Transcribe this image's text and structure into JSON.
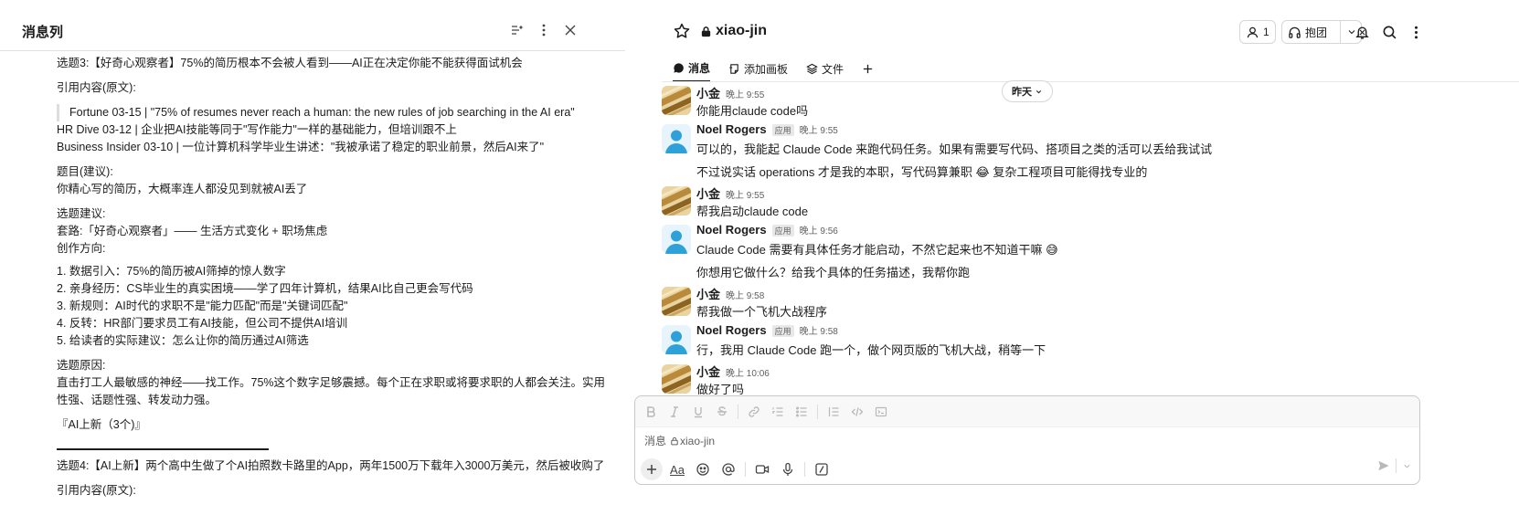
{
  "thread": {
    "title": "消息列",
    "lines": [
      {
        "text": "选题3:【好奇心观察者】75%的简历根本不会被人看到——AI正在决定你能不能获得面试机会",
        "gap": ""
      },
      {
        "text": "引用内容(原文):",
        "gap": "m"
      },
      {
        "text": "Fortune 03-15 | \"75% of resumes never reach a human: the new rules of job searching in the AI era\"",
        "quote": true
      },
      {
        "text": "HR Dive 03-12 | 企业把AI技能等同于\"写作能力\"一样的基础能力，但培训跟不上",
        "gap": ""
      },
      {
        "text": "Business Insider 03-10 | 一位计算机科学毕业生讲述：\"我被承诺了稳定的职业前景，然后AI来了\"",
        "gap": ""
      },
      {
        "text": "题目(建议):",
        "gap": "m"
      },
      {
        "text": "你精心写的简历，大概率连人都没见到就被AI丢了",
        "gap": ""
      },
      {
        "text": "选题建议:",
        "gap": "m"
      },
      {
        "text": "套路:「好奇心观察者」—— 生活方式变化 + 职场焦虑",
        "gap": ""
      },
      {
        "text": "创作方向:",
        "gap": ""
      },
      {
        "text": "1. 数据引入：75%的简历被AI筛掉的惊人数字",
        "gap": "s"
      },
      {
        "text": "2. 亲身经历：CS毕业生的真实困境——学了四年计算机，结果AI比自己更会写代码",
        "gap": ""
      },
      {
        "text": "3. 新规则：AI时代的求职不是\"能力匹配\"而是\"关键词匹配\"",
        "gap": ""
      },
      {
        "text": "4. 反转：HR部门要求员工有AI技能，但公司不提供AI培训",
        "gap": ""
      },
      {
        "text": "5. 给读者的实际建议：怎么让你的简历通过AI筛选",
        "gap": ""
      },
      {
        "text": "选题原因:",
        "gap": "m"
      },
      {
        "text": "直击打工人最敏感的神经——找工作。75%这个数字足够震撼。每个正在求职或将要求职的人都会关注。实用性强、话题性强、转发动力强。",
        "gap": "",
        "wrap": true
      },
      {
        "text": "『AI上新（3个)』",
        "gap": "m"
      }
    ],
    "after_divider": [
      {
        "text": "选题4:【AI上新】两个高中生做了个AI拍照数卡路里的App，两年1500万下载年入3000万美元，然后被收购了",
        "wrap": true
      },
      {
        "text": "引用内容(原文):",
        "gap": "m"
      }
    ]
  },
  "channel": {
    "name": "xiao-jin",
    "member_count": "1",
    "huddle_label": "抱团",
    "tabs": [
      {
        "label": "消息",
        "icon": "message-icon",
        "active": true
      },
      {
        "label": "添加画板",
        "icon": "canvas-icon",
        "active": false
      },
      {
        "label": "文件",
        "icon": "files-icon",
        "active": false
      }
    ],
    "date_divider": "昨天",
    "messages": [
      {
        "sender": "小金",
        "avatar": "gold",
        "time": "晚上 9:55",
        "app": false,
        "lines": [
          "你能用claude code吗"
        ]
      },
      {
        "sender": "Noel Rogers",
        "avatar": "user",
        "time": "晚上 9:55",
        "app": true,
        "app_tag": "应用",
        "lines": [
          "可以的，我能起 Claude Code 来跑代码任务。如果有需要写代码、搭项目之类的活可以丢给我试试",
          "不过说实话 operations 才是我的本职，写代码算兼职 😂 复杂工程项目可能得找专业的"
        ]
      },
      {
        "sender": "小金",
        "avatar": "gold",
        "time": "晚上 9:55",
        "app": false,
        "lines": [
          "帮我启动claude code"
        ]
      },
      {
        "sender": "Noel Rogers",
        "avatar": "user",
        "time": "晚上 9:56",
        "app": true,
        "app_tag": "应用",
        "lines": [
          "Claude Code 需要有具体任务才能启动，不然它起来也不知道干嘛 😅",
          "你想用它做什么？给我个具体的任务描述，我帮你跑"
        ]
      },
      {
        "sender": "小金",
        "avatar": "gold",
        "time": "晚上 9:58",
        "app": false,
        "lines": [
          "帮我做一个飞机大战程序"
        ]
      },
      {
        "sender": "Noel Rogers",
        "avatar": "user",
        "time": "晚上 9:58",
        "app": true,
        "app_tag": "应用",
        "lines": [
          "行，我用 Claude Code 跑一个，做个网页版的飞机大战，稍等一下"
        ]
      },
      {
        "sender": "小金",
        "avatar": "gold",
        "time": "晚上 10:06",
        "app": false,
        "lines": [
          "做好了吗"
        ]
      }
    ],
    "composer": {
      "placeholder_prefix": "消息",
      "placeholder_channel": "xiao-jin",
      "format_label": "Aa"
    }
  },
  "colors": {
    "text": "#1d1c1d",
    "muted": "#616061",
    "avatar_user_bg": "#e8f4fb",
    "avatar_user_fg": "#2ea1d9",
    "avatar_gold": "#b88a3a"
  }
}
